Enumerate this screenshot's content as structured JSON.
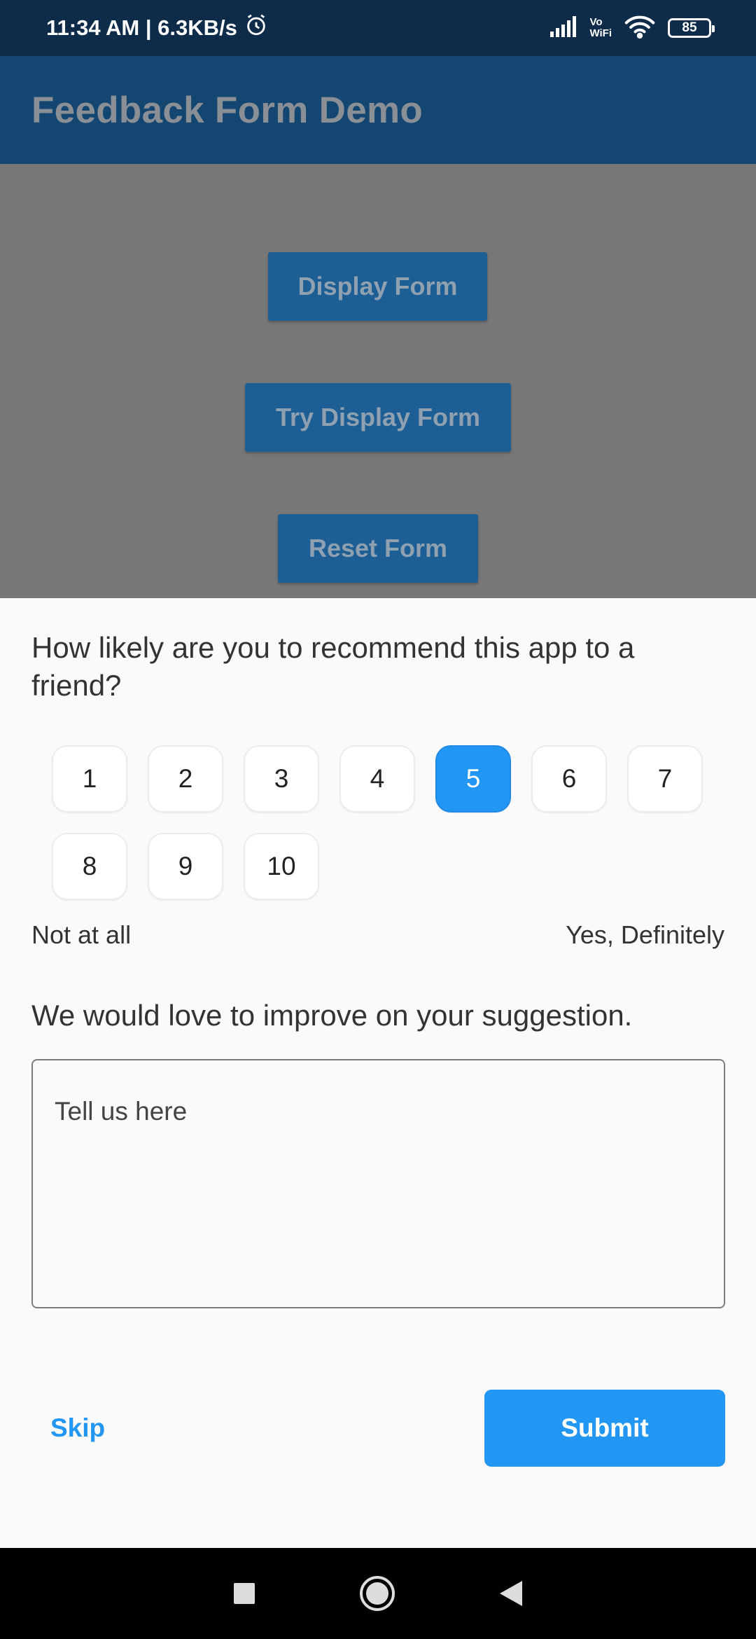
{
  "status_bar": {
    "time_speed": "11:34 AM | 6.3KB/s",
    "vowifi_top": "Vo",
    "vowifi_bottom": "WiFi",
    "battery": "85"
  },
  "app_bar": {
    "title": "Feedback Form Demo"
  },
  "background_buttons": {
    "display_form": "Display Form",
    "try_display_form": "Try Display Form",
    "reset_form": "Reset Form"
  },
  "sheet": {
    "question": "How likely are you to recommend this app to a friend?",
    "ratings": [
      "1",
      "2",
      "3",
      "4",
      "5",
      "6",
      "7",
      "8",
      "9",
      "10"
    ],
    "selected_rating": "5",
    "low_label": "Not at all",
    "high_label": "Yes, Definitely",
    "suggestion_prompt": "We would love to improve on your suggestion.",
    "textarea_placeholder": "Tell us here",
    "skip_label": "Skip",
    "submit_label": "Submit"
  },
  "colors": {
    "accent": "#2196f3",
    "app_bar": "#134671",
    "status_bar": "#0e2c49"
  }
}
